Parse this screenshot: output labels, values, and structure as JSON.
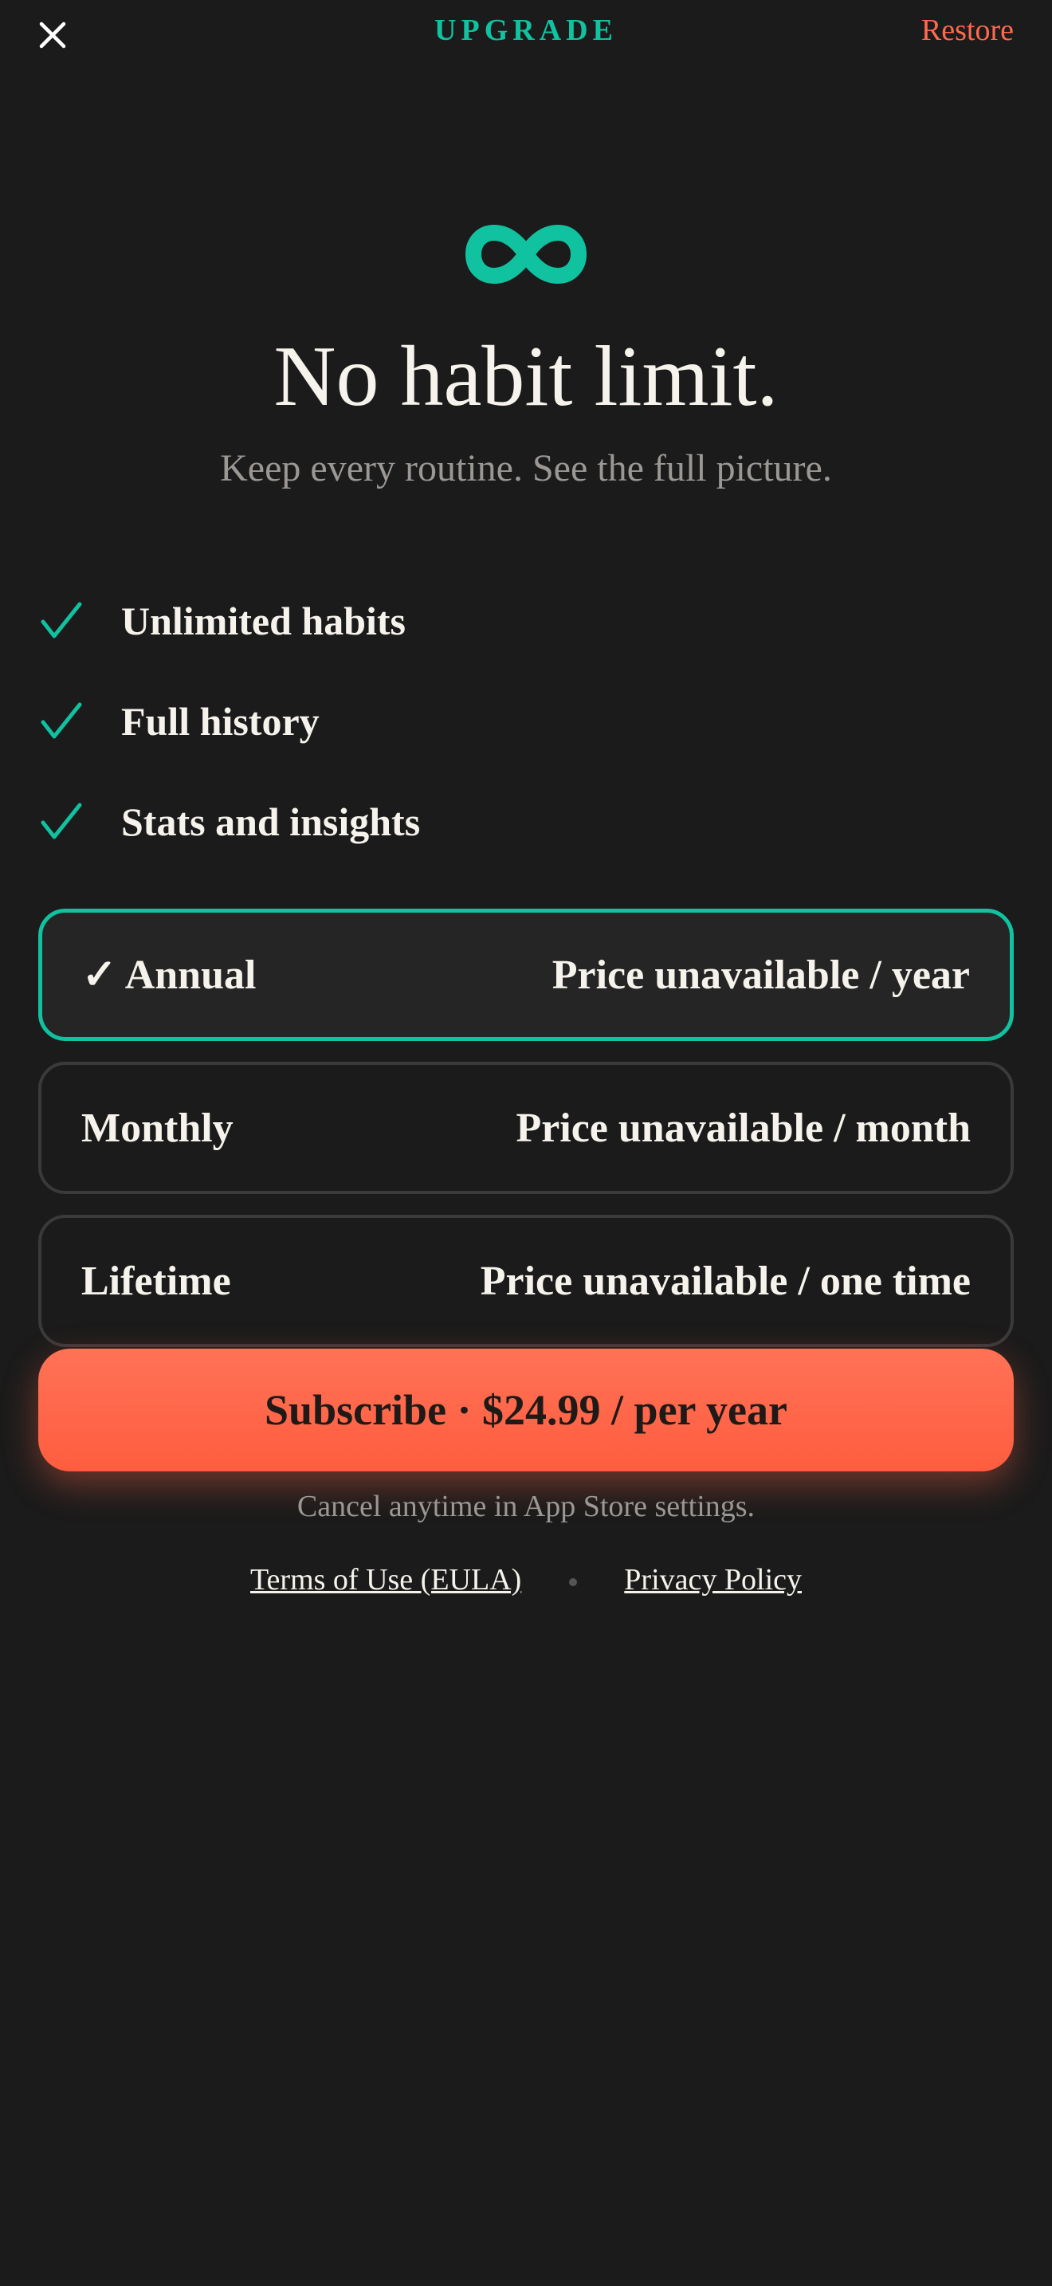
{
  "header": {
    "close_icon": "close-icon",
    "title": "UPGRADE",
    "restore_label": "Restore"
  },
  "hero": {
    "icon": "infinity-icon",
    "headline": "No habit limit.",
    "subheadline": "Keep every routine. See the full picture."
  },
  "features": [
    {
      "icon": "checkmark-icon",
      "label": "Unlimited habits"
    },
    {
      "icon": "checkmark-icon",
      "label": "Full history"
    },
    {
      "icon": "checkmark-icon",
      "label": "Stats and insights"
    }
  ],
  "plans": [
    {
      "name": "✓ Annual",
      "price": "Price unavailable / year",
      "selected": true
    },
    {
      "name": "Monthly",
      "price": "Price unavailable / month",
      "selected": false
    },
    {
      "name": "Lifetime",
      "price": "Price unavailable / one time",
      "selected": false
    }
  ],
  "cta": {
    "label": "Subscribe · $24.99 / per year"
  },
  "footer": {
    "cancel_note": "Cancel anytime in App Store settings.",
    "terms_label": "Terms of Use (EULA)",
    "privacy_label": "Privacy Policy"
  },
  "colors": {
    "background": "#1b1b1b",
    "accent_teal": "#10c2a0",
    "accent_coral": "#ff6a4d",
    "text_primary": "#f6f3ec",
    "text_muted": "#9a9794"
  }
}
